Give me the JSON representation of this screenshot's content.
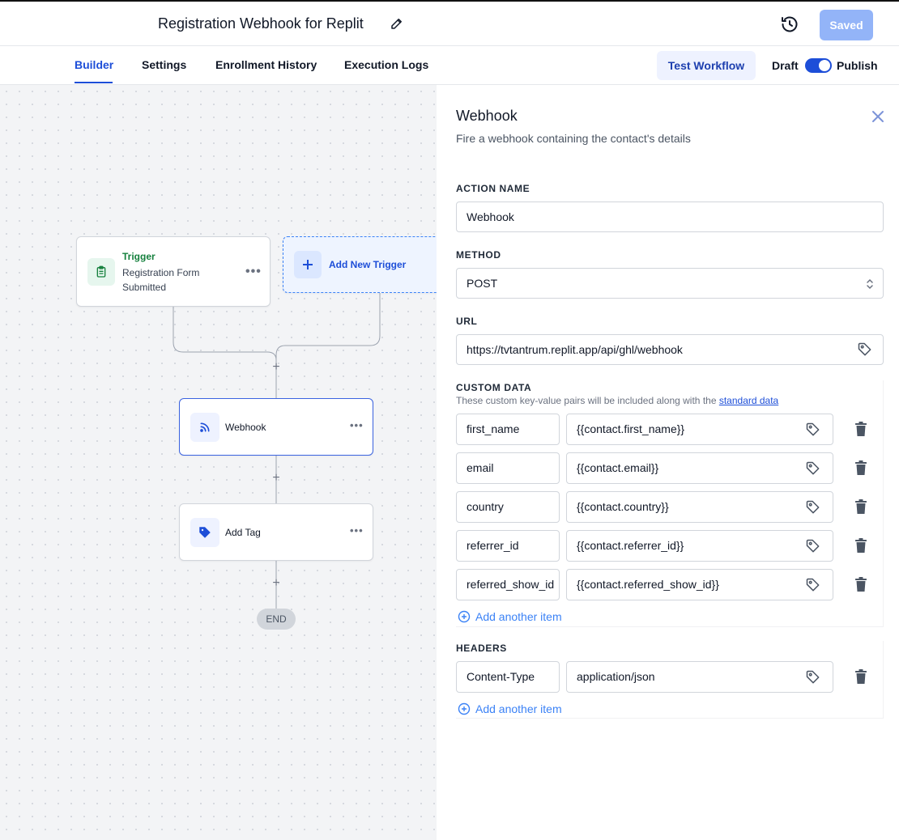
{
  "header": {
    "workflow_title": "Registration Webhook for Replit",
    "saved_label": "Saved"
  },
  "tabs": [
    {
      "label": "Builder",
      "active": true
    },
    {
      "label": "Settings",
      "active": false
    },
    {
      "label": "Enrollment History",
      "active": false
    },
    {
      "label": "Execution Logs",
      "active": false
    }
  ],
  "toolbar": {
    "test_workflow_label": "Test Workflow",
    "draft_label": "Draft",
    "publish_label": "Publish",
    "publish_toggle_on": true
  },
  "canvas": {
    "trigger": {
      "kind": "Trigger",
      "name": "Registration Form Submitted"
    },
    "add_trigger_label": "Add New Trigger",
    "actions": [
      {
        "label": "Webhook",
        "icon": "rss-icon"
      },
      {
        "label": "Add Tag",
        "icon": "tag-icon"
      }
    ],
    "plus_sign": "+",
    "end_label": "END",
    "more_glyph": "•••"
  },
  "panel": {
    "title": "Webhook",
    "subtitle": "Fire a webhook containing the contact's details",
    "action_name_label": "ACTION NAME",
    "action_name_value": "Webhook",
    "method_label": "METHOD",
    "method_value": "POST",
    "url_label": "URL",
    "url_value": "https://tvtantrum.replit.app/api/ghl/webhook",
    "custom_data_label": "CUSTOM DATA",
    "custom_data_help": "These custom key-value pairs will be included along with the",
    "custom_data_help_link": "standard data",
    "custom_data": [
      {
        "key": "first_name",
        "value": "{{contact.first_name}}"
      },
      {
        "key": "email",
        "value": "{{contact.email}}"
      },
      {
        "key": "country",
        "value": "{{contact.country}}"
      },
      {
        "key": "referrer_id",
        "value": "{{contact.referrer_id}}"
      },
      {
        "key": "referred_show_id",
        "value": "{{contact.referred_show_id}}"
      }
    ],
    "add_another_item": "Add another item",
    "headers_label": "HEADERS",
    "headers": [
      {
        "key": "Content-Type",
        "value": "application/json"
      }
    ]
  },
  "colors": {
    "accent": "#1d4ed8",
    "saved_button": "#93b4f8",
    "trigger_green": "#15803d"
  }
}
